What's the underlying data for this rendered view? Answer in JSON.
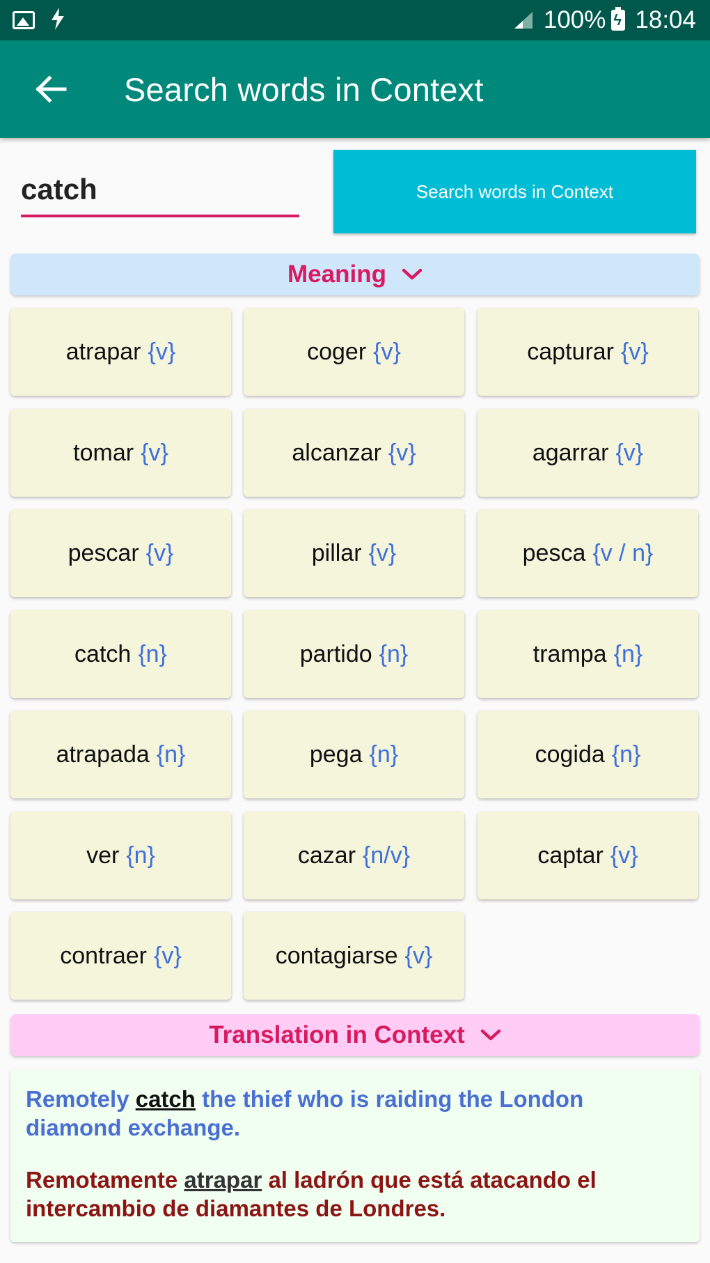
{
  "status_bar": {
    "battery_percent": "100%",
    "time": "18:04",
    "icons": [
      "gallery-icon",
      "flash-icon",
      "signal-icon",
      "battery-charging-icon"
    ]
  },
  "app_bar": {
    "title": "Search words in Context",
    "back_icon": "arrow-back-icon"
  },
  "search": {
    "value": "catch",
    "button_label": "Search words in Context"
  },
  "meaning": {
    "header": "Meaning",
    "items": [
      {
        "word": "atrapar",
        "pos": "{v}"
      },
      {
        "word": "coger",
        "pos": "{v}"
      },
      {
        "word": "capturar",
        "pos": "{v}"
      },
      {
        "word": "tomar",
        "pos": "{v}"
      },
      {
        "word": "alcanzar",
        "pos": "{v}"
      },
      {
        "word": "agarrar",
        "pos": "{v}"
      },
      {
        "word": "pescar",
        "pos": "{v}"
      },
      {
        "word": "pillar",
        "pos": "{v}"
      },
      {
        "word": "pesca",
        "pos": "{v / n}"
      },
      {
        "word": "catch",
        "pos": "{n}"
      },
      {
        "word": "partido",
        "pos": "{n}"
      },
      {
        "word": "trampa",
        "pos": "{n}"
      },
      {
        "word": "atrapada",
        "pos": "{n}"
      },
      {
        "word": "pega",
        "pos": "{n}"
      },
      {
        "word": "cogida",
        "pos": "{n}"
      },
      {
        "word": "ver",
        "pos": "{n}"
      },
      {
        "word": "cazar",
        "pos": "{n/v}"
      },
      {
        "word": "captar",
        "pos": "{v}"
      },
      {
        "word": "contraer",
        "pos": "{v}"
      },
      {
        "word": "contagiarse",
        "pos": "{v}"
      }
    ]
  },
  "context": {
    "header": "Translation in Context",
    "english": {
      "before": "Remotely ",
      "highlight": "catch",
      "after": " the thief who is raiding the London diamond exchange."
    },
    "spanish": {
      "before": "Remotamente ",
      "highlight": "atrapar",
      "after": " al ladrón que está atacando el intercambio de diamantes de Londres."
    }
  },
  "colors": {
    "status_bar": "#00574b",
    "app_bar": "#00897b",
    "search_button": "#00bcd4",
    "accent": "#d81b60",
    "meaning_header_bg": "#cfe6fb",
    "context_header_bg": "#ffccf6",
    "card_bg": "#f5f5dc",
    "pos_color": "#3f6fd8",
    "english_color": "#4a6fd3",
    "spanish_color": "#8b1414"
  }
}
